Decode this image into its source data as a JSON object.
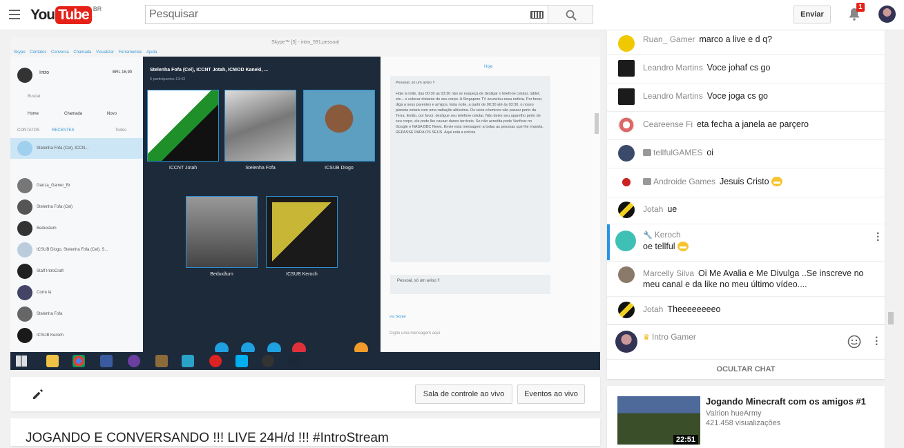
{
  "header": {
    "logo_you": "You",
    "logo_tube": "Tube",
    "country": "BR",
    "search_placeholder": "Pesquisar",
    "upload_label": "Enviar",
    "notification_count": "1"
  },
  "video": {
    "skype_window_title": "Skype™ [5] - intro_591.pessoal",
    "skype_menu": "Skype Contatos Conversa Chamada Visualizar Ferramentas Ajuda",
    "call_title": "Stelenha Fofa (Cel), ICCNT Jotah, ICMOD Kaneki, ...",
    "call_participants": "5 participantes 13:43",
    "tiles": [
      "ICCNT Jotah",
      "Stelenha Fofa",
      "ICSUB Diogo",
      "Beduxãum",
      "ICSUB Keroch"
    ],
    "left_profile_name": "Intro",
    "left_balance": "BRL 16,90",
    "left_search": "Buscar",
    "left_nav": [
      "Home",
      "Chamada",
      "Novo"
    ],
    "left_tabs": [
      "CONTATOS",
      "RECENTES",
      "Todos"
    ],
    "left_contacts": [
      "Stelenha Fofa (Cel), ICCN...",
      "Ganza_Gamer_Br",
      "Stelenha Fofa (Cel)",
      "Beduxãum",
      "ICSUB Diogo, Stelenha Fofa (Cel), S...",
      "Staff IntroCraft",
      "Corre lá",
      "Stelenha Fofa",
      "ICSUB Keroch"
    ],
    "right_today": "Hoje",
    "message_title": "Pessoal, só um aviso !!",
    "message_body": "Hoje à noite, das 00:30 as 03:30 não se esqueça de desligar o telefone celular, tablet, etc... e colocar distante do seu corpo. A Singapore TV anunciou essa notícia. Por favor, diga a seus parentes e amigos. Esta noite, a partir de 00:30 até às 03:30, o nosso planeta estará com uma radiação altíssima. Os raios cósmicos vão passar perto da Terra. Então, por favor, desligue seu telefone celular. Não deixe seu aparelho perto de seu corpo, ele pode lhe causar danos terríveis. Se não acredita pode Verificar no Google e NASA BBC News. Envie esta mensagem a todas as pessoas que lhe importa. REPASSE PARA OS SEUS. Aqui está a notícia",
    "reply_preview": "Pessoal, só um aviso !!",
    "input_placeholder": "Digite uma mensagem aqui",
    "via": "via Skype"
  },
  "actions": {
    "control_room": "Sala de controle ao vivo",
    "live_events": "Eventos ao vivo"
  },
  "video_title": "JOGANDO E CONVERSANDO !!! LIVE 24H/d !!! #IntroStream",
  "chat": {
    "messages": [
      {
        "author": "Ruan_ Gamer",
        "text": "marco a live e d q?"
      },
      {
        "author": "Leandro Martins",
        "text": "Voce johaf cs go"
      },
      {
        "author": "Leandro Martins",
        "text": "Voce joga cs go"
      },
      {
        "author": "Ceareense Fi",
        "text": "eta fecha a janela ae parçero"
      },
      {
        "author": "tellfulGAMES",
        "text": "oi"
      },
      {
        "author": "Androide Games",
        "text": "Jesuis Cristo"
      },
      {
        "author": "Jotah",
        "text": "ue"
      },
      {
        "author": "Keroch",
        "text": "oe tellful"
      },
      {
        "author": "Marcelly Silva",
        "text": "Oi Me Avalia e Me Divulga ..Se inscreve no meu canal e da like no meu último vídeo...."
      },
      {
        "author": "Jotah",
        "text": "Theeeeeeeeo"
      }
    ],
    "current_user": "Intro Gamer",
    "hide_chat": "OCULTAR CHAT"
  },
  "recommended": {
    "title": "Jogando Minecraft com os amigos #1",
    "channel": "Valrion hueArmy",
    "views": "421.458 visualizações",
    "duration": "22:51"
  },
  "colors": {
    "brand_red": "#e62117",
    "highlight_blue": "#2793e6"
  }
}
